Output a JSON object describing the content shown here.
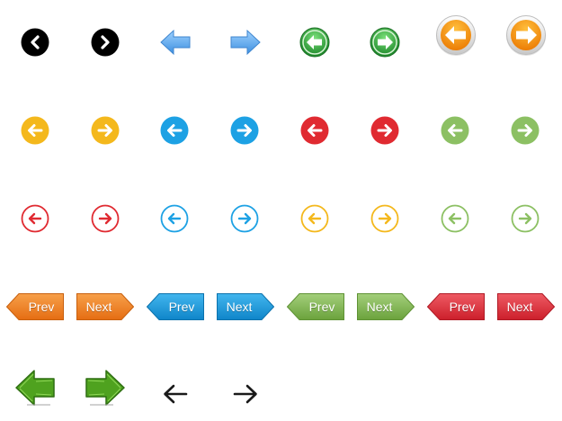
{
  "colors": {
    "black": "#000000",
    "blue_flat": "#5aa9e9",
    "green_dark": "#2e9a3d",
    "orange": "#f38f10",
    "yellow": "#f4b81c",
    "blue": "#1da1e4",
    "red": "#e02a31",
    "light_green": "#8cc063",
    "tag_orange": "#ee7a1e",
    "tag_blue": "#1895d6",
    "tag_green": "#78b048",
    "tag_red": "#d92b36",
    "sketch_green": "#4fa21f"
  },
  "icons": [
    "prev-black-round-icon",
    "next-black-round-icon",
    "left-arrow-blue-icon",
    "right-arrow-blue-icon",
    "prev-green-glossy-icon",
    "next-green-glossy-icon",
    "prev-orange-glossy-icon",
    "next-orange-glossy-icon",
    "prev-yellow-circle-icon",
    "next-yellow-circle-icon",
    "prev-blue-circle-icon",
    "next-blue-circle-icon",
    "prev-red-circle-icon",
    "next-red-circle-icon",
    "prev-light-green-circle-icon",
    "next-light-green-circle-icon",
    "prev-red-outline-icon",
    "next-red-outline-icon",
    "prev-blue-outline-icon",
    "next-blue-outline-icon",
    "prev-yellow-outline-icon",
    "next-yellow-outline-icon",
    "prev-green-outline-icon",
    "next-green-outline-icon",
    "left-sketch-arrow-icon",
    "right-sketch-arrow-icon",
    "left-thin-arrow-icon",
    "right-thin-arrow-icon"
  ],
  "tags": {
    "orange": {
      "prev": "Prev",
      "next": "Next"
    },
    "blue": {
      "prev": "Prev",
      "next": "Next"
    },
    "green": {
      "prev": "Prev",
      "next": "Next"
    },
    "red": {
      "prev": "Prev",
      "next": "Next"
    }
  }
}
